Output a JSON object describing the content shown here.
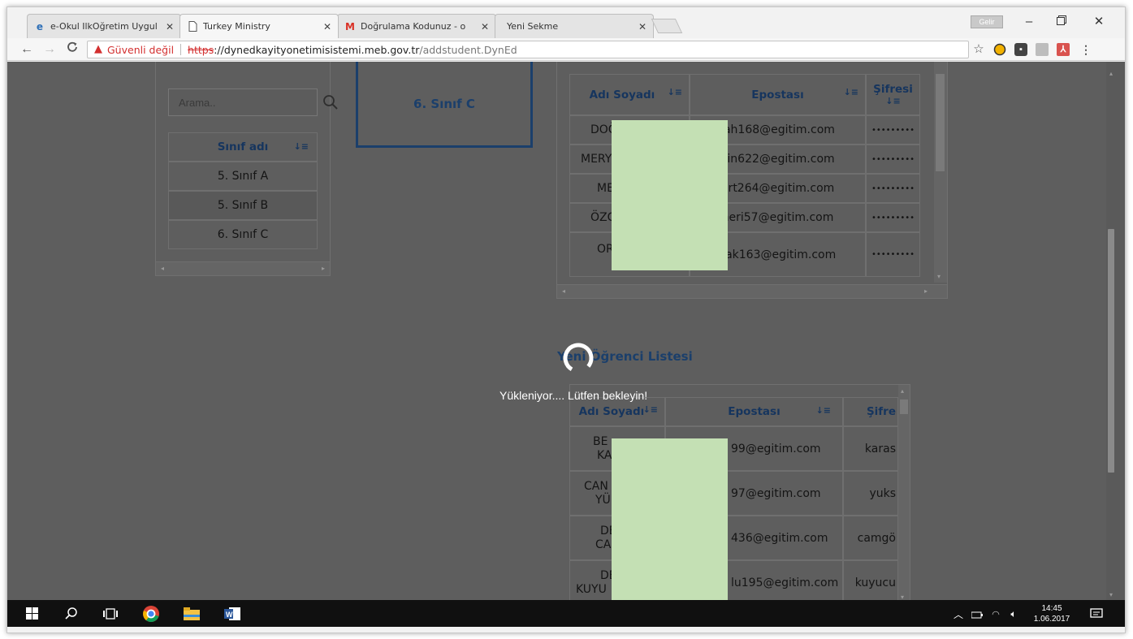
{
  "browser": {
    "tabs": [
      {
        "label": "e-Okul IlkOğretim Uygul",
        "favicon": "eokul-icon"
      },
      {
        "label": "Turkey Ministry",
        "favicon": "page-icon"
      },
      {
        "label": "Doğrulama Kodunuz - o",
        "favicon": "gmail-icon"
      },
      {
        "label": "Yeni Sekme",
        "favicon": "blank-icon"
      }
    ],
    "active_tab": 1,
    "tab_close_glyph": "✕",
    "security_label": "Güvenli değil",
    "url_scheme": "https",
    "url_host": "://dynedkayityonetimisistemi.meb.gov.tr",
    "url_path": "/addstudent.DynEd",
    "profile_label": "Gelir"
  },
  "left_panel": {
    "search_placeholder": "Arama..",
    "header": "Sınıf adı",
    "rows": [
      "5. Sınıf A",
      "5. Sınıf B",
      "6. Sınıf C"
    ]
  },
  "selected_class": {
    "label": "6. Sınıf C"
  },
  "existing_students": {
    "headers": {
      "name": "Adı Soyadı",
      "email": "Epostası",
      "password": "Şifresi"
    },
    "rows": [
      {
        "name": "DOĞ",
        "email": "lah168@egitim.com",
        "password": "•••••••••"
      },
      {
        "name": "MERY",
        "email": "kin622@egitim.com",
        "password": "•••••••••"
      },
      {
        "name": "ME",
        "email": "urt264@egitim.com",
        "password": "•••••••••"
      },
      {
        "name": "ÖZG",
        "email": "neri57@egitim.com",
        "password": "•••••••••"
      },
      {
        "name": "OR",
        "email": "zak163@egitim.com",
        "password": "•••••••••"
      }
    ]
  },
  "new_students": {
    "title": "Yeni Öğrenci Listesi",
    "headers": {
      "name": "Adı Soyadı",
      "email": "Epostası",
      "password": "Şifre"
    },
    "rows": [
      {
        "name_line1": "BE",
        "name_line2": "KA",
        "email": "99@egitim.com",
        "password": "karas"
      },
      {
        "name_line1": "CAN",
        "name_line2": "YÜ",
        "email": "97@egitim.com",
        "password": "yuks"
      },
      {
        "name_line1": "DE",
        "name_line2": "CA",
        "email": "436@egitim.com",
        "password": "camgö"
      },
      {
        "name_line1": "DE",
        "name_line2": "KUYU",
        "email": "lu195@egitim.com",
        "password": "kuyucu"
      }
    ]
  },
  "loading": {
    "text": "Yükleniyor.... Lütfen bekleyin!"
  },
  "taskbar": {
    "time": "14:45",
    "date": "1.06.2017"
  },
  "colors": {
    "overlay": "#5e5e5e",
    "accent_navy": "#1b3f6b",
    "warning_red": "#d32f2f",
    "redaction_green": "#c4e0b4"
  }
}
